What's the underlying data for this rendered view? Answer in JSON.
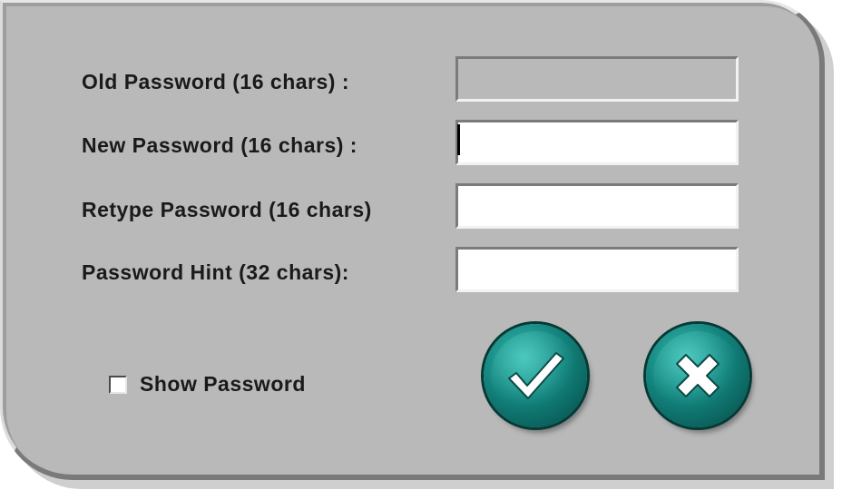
{
  "form": {
    "old_password_label": "Old Password (16 chars) :",
    "new_password_label": "New Password (16 chars) :",
    "retype_password_label": "Retype Password (16 chars)",
    "password_hint_label": "Password Hint (32 chars):",
    "old_password_value": "",
    "new_password_value": "",
    "retype_password_value": "",
    "password_hint_value": ""
  },
  "options": {
    "show_password_label": "Show Password",
    "show_password_checked": false
  },
  "actions": {
    "ok_icon": "checkmark-icon",
    "cancel_icon": "x-icon"
  },
  "colors": {
    "dialog_background": "#b9b9b9",
    "button_teal": "#12837c",
    "field_background": "#ffffff"
  }
}
